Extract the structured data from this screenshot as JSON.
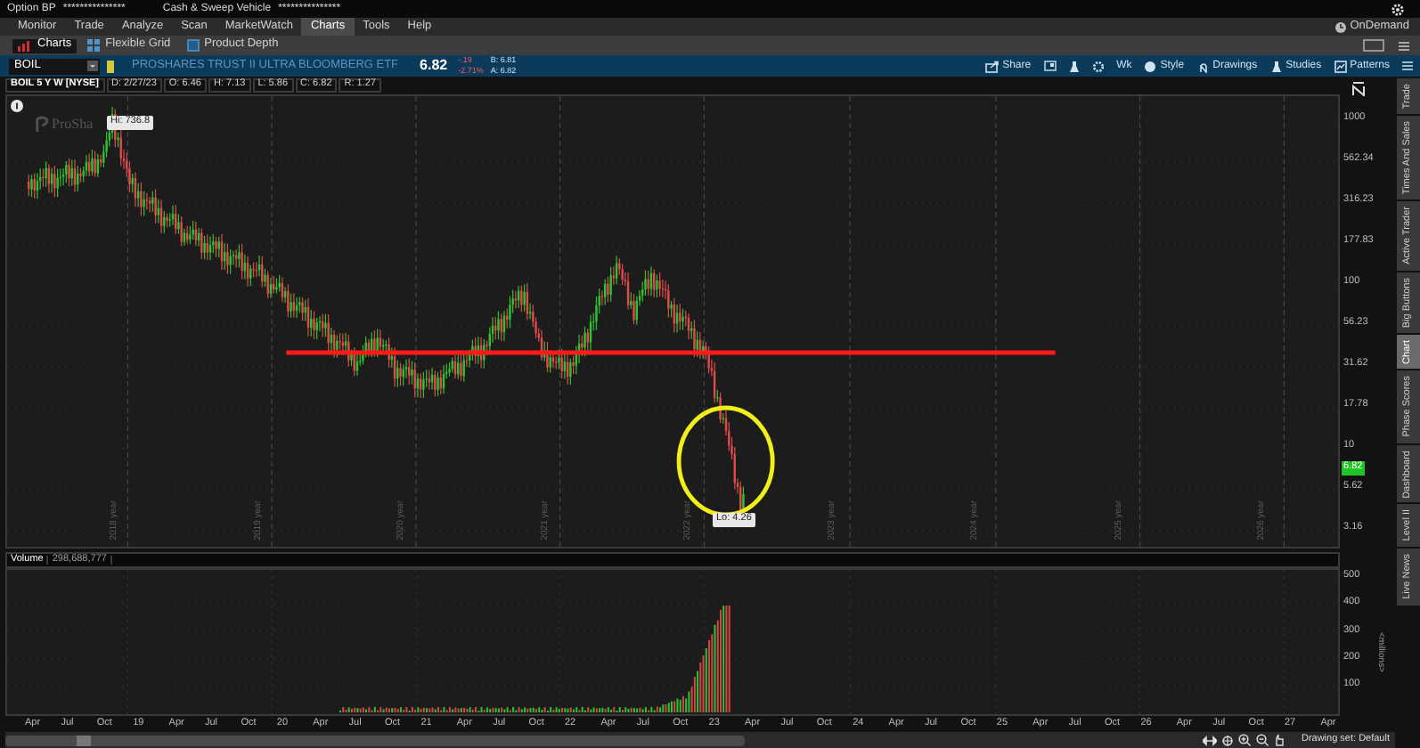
{
  "account_bar": {
    "label_1": "Option BP",
    "value_1": "***************",
    "label_2": "Cash & Sweep Vehicle",
    "value_2": "***************"
  },
  "menu": [
    {
      "label": "Monitor",
      "selected": false
    },
    {
      "label": "Trade",
      "selected": false
    },
    {
      "label": "Analyze",
      "selected": false
    },
    {
      "label": "Scan",
      "selected": false
    },
    {
      "label": "MarketWatch",
      "selected": false
    },
    {
      "label": "Charts",
      "selected": true
    },
    {
      "label": "Tools",
      "selected": false
    },
    {
      "label": "Help",
      "selected": false
    }
  ],
  "on_demand": "OnDemand",
  "subtabs": [
    {
      "label": "Charts",
      "selected": true
    },
    {
      "label": "Flexible Grid",
      "selected": false
    },
    {
      "label": "Product Depth",
      "selected": false
    }
  ],
  "symbol_bar": {
    "symbol": "BOIL",
    "description": "PROSHARES TRUST II ULTRA BLOOMBERG ETF",
    "last": "6.82",
    "change": "-.19",
    "change_pct": "-2.71%",
    "bid": "B: 6.81",
    "ask": "A: 6.82"
  },
  "toolbar": [
    "Share",
    "Wk",
    "Style",
    "Drawings",
    "Studies",
    "Patterns"
  ],
  "chart_header": [
    "BOIL 5 Y W [NYSE]",
    "D: 2/27/23",
    "O: 6.46",
    "H: 7.13",
    "L: 5.86",
    "C: 6.82",
    "R: 1.27"
  ],
  "price_chart": {
    "logo": "ProSha",
    "high_label": "Hi: 736.8",
    "low_label": "Lo: 4.26",
    "last_price": "6.82",
    "year_labels": [
      "2018 year",
      "2019 year",
      "2020 year",
      "2021 year",
      "2022 year",
      "2023 year",
      "2024 year",
      "2025 year",
      "2026 year"
    ],
    "y_axis": [
      "1000",
      "562.34",
      "316.23",
      "177.83",
      "100",
      "56.23",
      "31.62",
      "17.78",
      "10",
      "5.62",
      "3.16"
    ]
  },
  "volume": {
    "title": "Volume",
    "value": "298,688,777",
    "y_axis": [
      "500",
      "400",
      "300",
      "200",
      "100"
    ],
    "unit": "<millions>"
  },
  "x_axis": [
    "Apr",
    "Jul",
    "Oct",
    "19",
    "Apr",
    "Jul",
    "Oct",
    "20",
    "Apr",
    "Jul",
    "Oct",
    "21",
    "Apr",
    "Jul",
    "Oct",
    "22",
    "Apr",
    "Jul",
    "Oct",
    "23",
    "Apr",
    "Jul",
    "Oct",
    "24",
    "Apr",
    "Jul",
    "Oct",
    "25",
    "Apr",
    "Jul",
    "Oct",
    "26",
    "Apr",
    "Jul",
    "Oct",
    "27",
    "Apr"
  ],
  "status": {
    "drawing_set": "Drawing set: Default"
  },
  "side_tabs": [
    {
      "label": "Trade",
      "selected": false
    },
    {
      "label": "Times And Sales",
      "selected": false
    },
    {
      "label": "Active Trader",
      "selected": false
    },
    {
      "label": "Big Buttons",
      "selected": false
    },
    {
      "label": "Chart",
      "selected": true
    },
    {
      "label": "Phase Scores",
      "selected": false
    },
    {
      "label": "Dashboard",
      "selected": false
    },
    {
      "label": "Level II",
      "selected": false
    },
    {
      "label": "Live News",
      "selected": false
    }
  ]
}
